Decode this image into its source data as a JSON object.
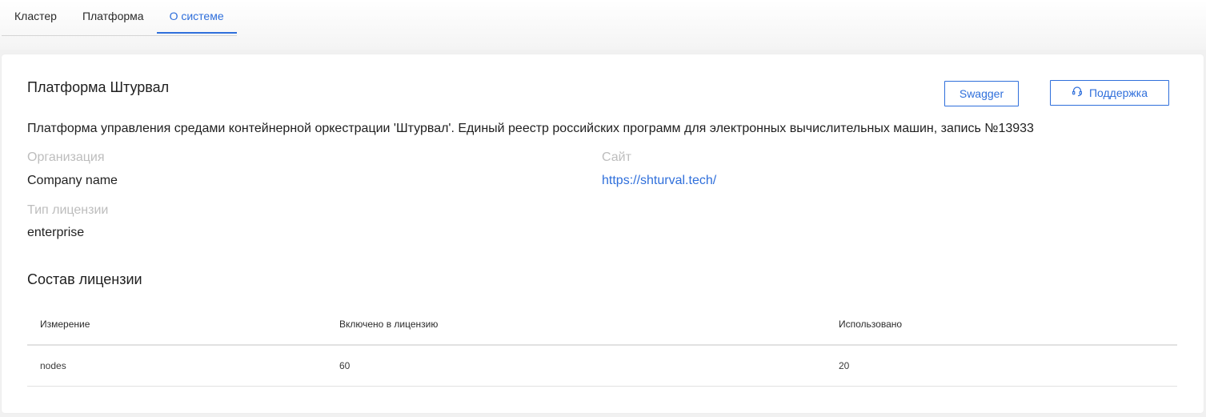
{
  "tabs": [
    {
      "label": "Кластер",
      "active": false
    },
    {
      "label": "Платформа",
      "active": false
    },
    {
      "label": "О системе",
      "active": true
    }
  ],
  "header": {
    "title": "Платформа Штурвал",
    "swagger_label": "Swagger",
    "support_label": "Поддержка",
    "support_icon": "headset-icon"
  },
  "description": "Платформа управления средами контейнерной оркестрации 'Штурвал'. Единый реестр российских программ для электронных вычислительных машин, запись №13933",
  "info": {
    "organization_label": "Организация",
    "organization_value": "Company name",
    "site_label": "Сайт",
    "site_value": "https://shturval.tech/",
    "license_type_label": "Тип лицензии",
    "license_type_value": "enterprise"
  },
  "license": {
    "title": "Состав лицензии",
    "columns": [
      "Измерение",
      "Включено в лицензию",
      "Использовано"
    ],
    "rows": [
      [
        "nodes",
        "60",
        "20"
      ]
    ]
  },
  "colors": {
    "accent": "#2f6fdb",
    "muted_label": "#bdbdbd",
    "background": "#f1f1f1",
    "card": "#ffffff"
  }
}
